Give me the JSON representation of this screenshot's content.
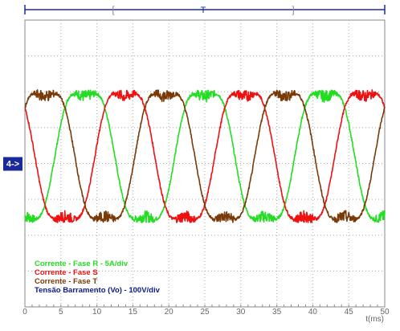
{
  "chart_data": {
    "type": "line",
    "title": "",
    "xlabel": "t(ms)",
    "ylabel": "",
    "xlim": [
      0,
      50
    ],
    "ylim": [
      -4,
      4
    ],
    "x_ticks": [
      0,
      5,
      10,
      15,
      20,
      25,
      30,
      35,
      40,
      45,
      50
    ],
    "y_grid_divisions": 8,
    "grid": true,
    "legend_position": "bottom-left",
    "trigger_marker": "T",
    "bracket_left": "[",
    "bracket_right": "]",
    "channel_marker": "4->",
    "channel_marker_level_div": 0.0,
    "series": [
      {
        "name": "Corrente - Fase R - 5A/div",
        "color": "#22dd22",
        "amplitude_div": 2.1,
        "offset_div": 0.2,
        "frequency_hz": 60,
        "phase_deg": -90,
        "x": [
          0,
          2.08,
          4.17,
          6.25,
          8.33,
          10.42,
          12.5,
          14.58,
          16.67,
          18.75,
          20.83,
          22.92,
          25,
          27.08,
          29.17,
          31.25,
          33.33,
          35.42,
          37.5,
          39.58,
          41.67,
          43.75,
          45.83,
          47.92,
          50
        ],
        "y": [
          -1.9,
          0.0,
          1.9,
          2.2,
          1.9,
          0.0,
          -1.9,
          -2.2,
          -1.9,
          0.0,
          1.9,
          2.2,
          1.9,
          0.0,
          -1.9,
          -2.2,
          -1.9,
          0.0,
          1.9,
          2.2,
          1.9,
          0.0,
          -1.9,
          -2.2,
          -1.9
        ]
      },
      {
        "name": "Corrente - Fase S",
        "color": "#ee1111",
        "amplitude_div": 2.1,
        "offset_div": 0.2,
        "frequency_hz": 60,
        "phase_deg": 150
      },
      {
        "name": "Corrente - Fase T",
        "color": "#7a3a08",
        "amplitude_div": 2.1,
        "offset_div": 0.2,
        "frequency_hz": 60,
        "phase_deg": 30
      },
      {
        "name": "Tensão Barramento (Vo) - 100V/div",
        "color": "#0a1a8a",
        "legend_only": true
      }
    ]
  }
}
